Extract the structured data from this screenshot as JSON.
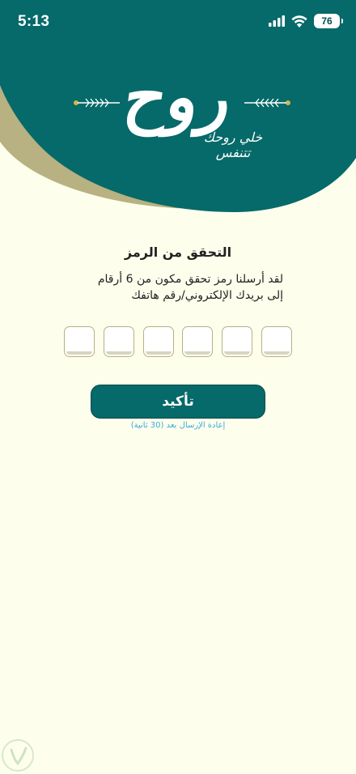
{
  "status_bar": {
    "time": "5:13",
    "battery_level": "76",
    "icons": [
      "signal-icon",
      "wifi-icon",
      "battery-icon"
    ]
  },
  "header": {
    "logo_text": "روح",
    "tagline": "خلي روحك تتنفس",
    "colors": {
      "primary": "#056a69",
      "accent": "#b8b181",
      "ornament": "#d6b54a"
    }
  },
  "verification": {
    "title": "التحقق من الرمز",
    "description_line1": "لقد أرسلنا رمز تحقق مكون من 6 أرقام",
    "description_line2": "إلى بريدك الإلكتروني/رقم هاتفك",
    "otp_digits": [
      "",
      "",
      "",
      "",
      "",
      ""
    ],
    "confirm_label": "تأكيد",
    "resend_text": "إعادة الإرسال بعد (30 ثانية)"
  },
  "colors": {
    "background": "#fdffec",
    "button": "#056a69",
    "link": "#3aa8dd"
  }
}
